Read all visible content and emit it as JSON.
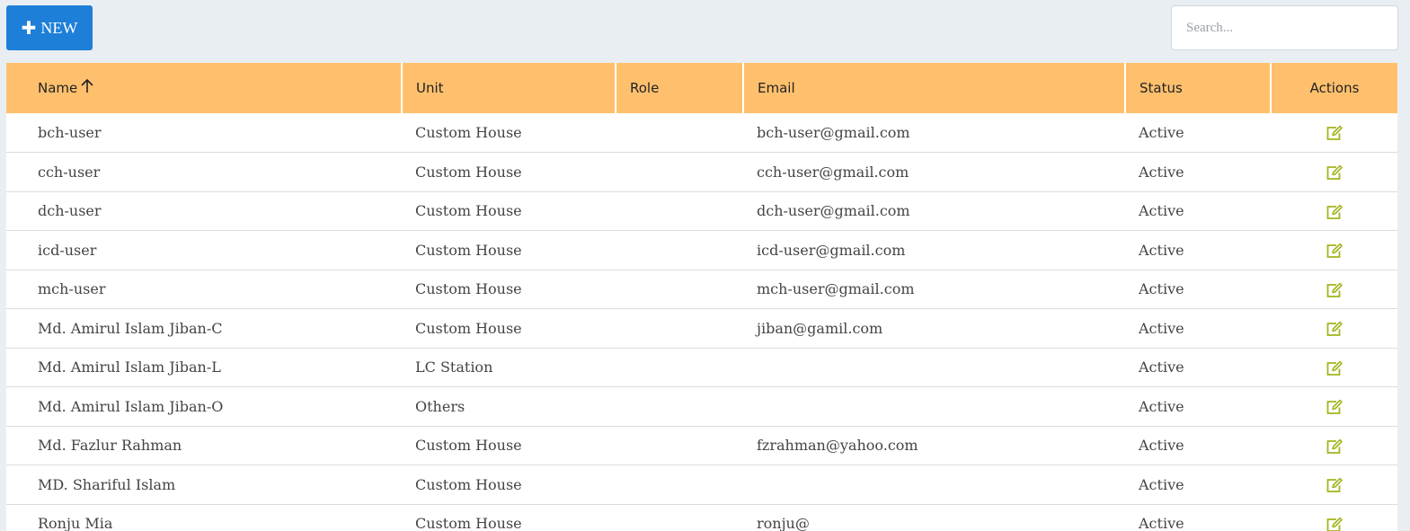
{
  "toolbar": {
    "new_label": "NEW",
    "new_icon": "plus-icon",
    "search_placeholder": "Search..."
  },
  "table": {
    "headers": {
      "name": "Name",
      "unit": "Unit",
      "role": "Role",
      "email": "Email",
      "status": "Status",
      "actions": "Actions"
    },
    "sort": {
      "column": "name",
      "direction": "ascending",
      "icon": "arrow-up-icon"
    },
    "rows": [
      {
        "name": "bch-user",
        "unit": "Custom House",
        "role": "",
        "email": "bch-user@gmail.com",
        "status": "Active"
      },
      {
        "name": "cch-user",
        "unit": "Custom House",
        "role": "",
        "email": "cch-user@gmail.com",
        "status": "Active"
      },
      {
        "name": "dch-user",
        "unit": "Custom House",
        "role": "",
        "email": "dch-user@gmail.com",
        "status": "Active"
      },
      {
        "name": "icd-user",
        "unit": "Custom House",
        "role": "",
        "email": "icd-user@gmail.com",
        "status": "Active"
      },
      {
        "name": "mch-user",
        "unit": "Custom House",
        "role": "",
        "email": "mch-user@gmail.com",
        "status": "Active"
      },
      {
        "name": "Md. Amirul Islam Jiban-C",
        "unit": "Custom House",
        "role": "",
        "email": "jiban@gamil.com",
        "status": "Active"
      },
      {
        "name": "Md. Amirul Islam Jiban-L",
        "unit": "LC Station",
        "role": "",
        "email": "",
        "status": "Active"
      },
      {
        "name": "Md. Amirul Islam Jiban-O",
        "unit": "Others",
        "role": "",
        "email": "",
        "status": "Active"
      },
      {
        "name": "Md. Fazlur Rahman",
        "unit": "Custom House",
        "role": "",
        "email": "fzrahman@yahoo.com",
        "status": "Active"
      },
      {
        "name": "MD. Shariful Islam",
        "unit": "Custom House",
        "role": "",
        "email": "",
        "status": "Active"
      },
      {
        "name": "Ronju Mia",
        "unit": "Custom House",
        "role": "",
        "email": "ronju@",
        "status": "Active"
      }
    ],
    "action_icon": "edit-icon"
  },
  "colors": {
    "page_background": "#e9eef3",
    "primary_button": "#1e7fd8",
    "header_background": "#ffc06e",
    "edit_icon": "#a4b41e"
  }
}
